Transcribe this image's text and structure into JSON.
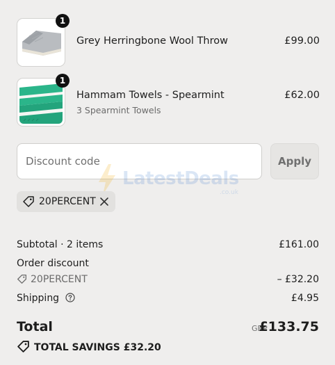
{
  "items": [
    {
      "title": "Grey Herringbone Wool Throw",
      "variant": "",
      "price": "£99.00",
      "quantity": "1",
      "image_icon": "grey-throw-icon"
    },
    {
      "title": "Hammam Towels - Spearmint",
      "variant": "3 Spearmint Towels",
      "price": "£62.00",
      "quantity": "1",
      "image_icon": "spearmint-towels-icon"
    }
  ],
  "discount": {
    "placeholder": "Discount code",
    "apply_label": "Apply",
    "applied_code": "20PERCENT"
  },
  "watermark": {
    "text": "LatestDeals",
    "sub": ".co.uk"
  },
  "summary": {
    "subtotal_label": "Subtotal · 2 items",
    "subtotal_value": "£161.00",
    "order_discount_label": "Order discount",
    "order_discount_code": "20PERCENT",
    "order_discount_value": "– £32.20",
    "shipping_label": "Shipping",
    "shipping_value": "£4.95",
    "total_label": "Total",
    "currency": "GBP",
    "total_value": "£133.75",
    "savings_label": "TOTAL SAVINGS £32.20"
  },
  "colors": {
    "background": "#efeeed",
    "badge": "#111111",
    "towel_green": "#2bb58a"
  }
}
